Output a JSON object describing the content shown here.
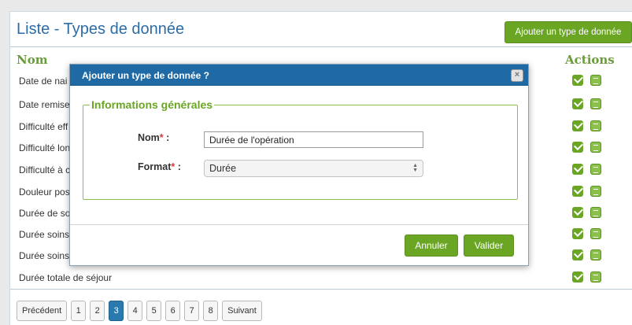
{
  "page": {
    "title": "Liste - Types de donnée",
    "add_button": "Ajouter un type de donnée",
    "col_name": "Nom",
    "col_actions": "Actions"
  },
  "rows": [
    {
      "name": "Date de nai"
    },
    {
      "name": "Date remise"
    },
    {
      "name": "Difficulté eff"
    },
    {
      "name": "Difficulté lon"
    },
    {
      "name": "Difficulté à c"
    },
    {
      "name": "Douleur pos"
    },
    {
      "name": "Durée de so"
    },
    {
      "name": "Durée soins"
    },
    {
      "name": "Durée soins"
    },
    {
      "name": "Durée totale de séjour"
    }
  ],
  "pagination": {
    "prev": "Précédent",
    "pages": [
      "1",
      "2",
      "3",
      "4",
      "5",
      "6",
      "7",
      "8"
    ],
    "active_page": "3",
    "next": "Suivant"
  },
  "modal": {
    "title": "Ajouter un type de donnée ?",
    "close_glyph": "×",
    "legend": "Informations générales",
    "name_label": "Nom",
    "format_label": "Format",
    "required_marker": "*",
    "colon": ":",
    "name_value": "Durée de l'opération",
    "format_value": "Durée",
    "cancel": "Annuler",
    "validate": "Valider"
  },
  "colors": {
    "accent_green": "#6aa524",
    "header_blue": "#1f6aa5",
    "title_blue": "#2c6ca8",
    "required_red": "#d43a3a"
  }
}
